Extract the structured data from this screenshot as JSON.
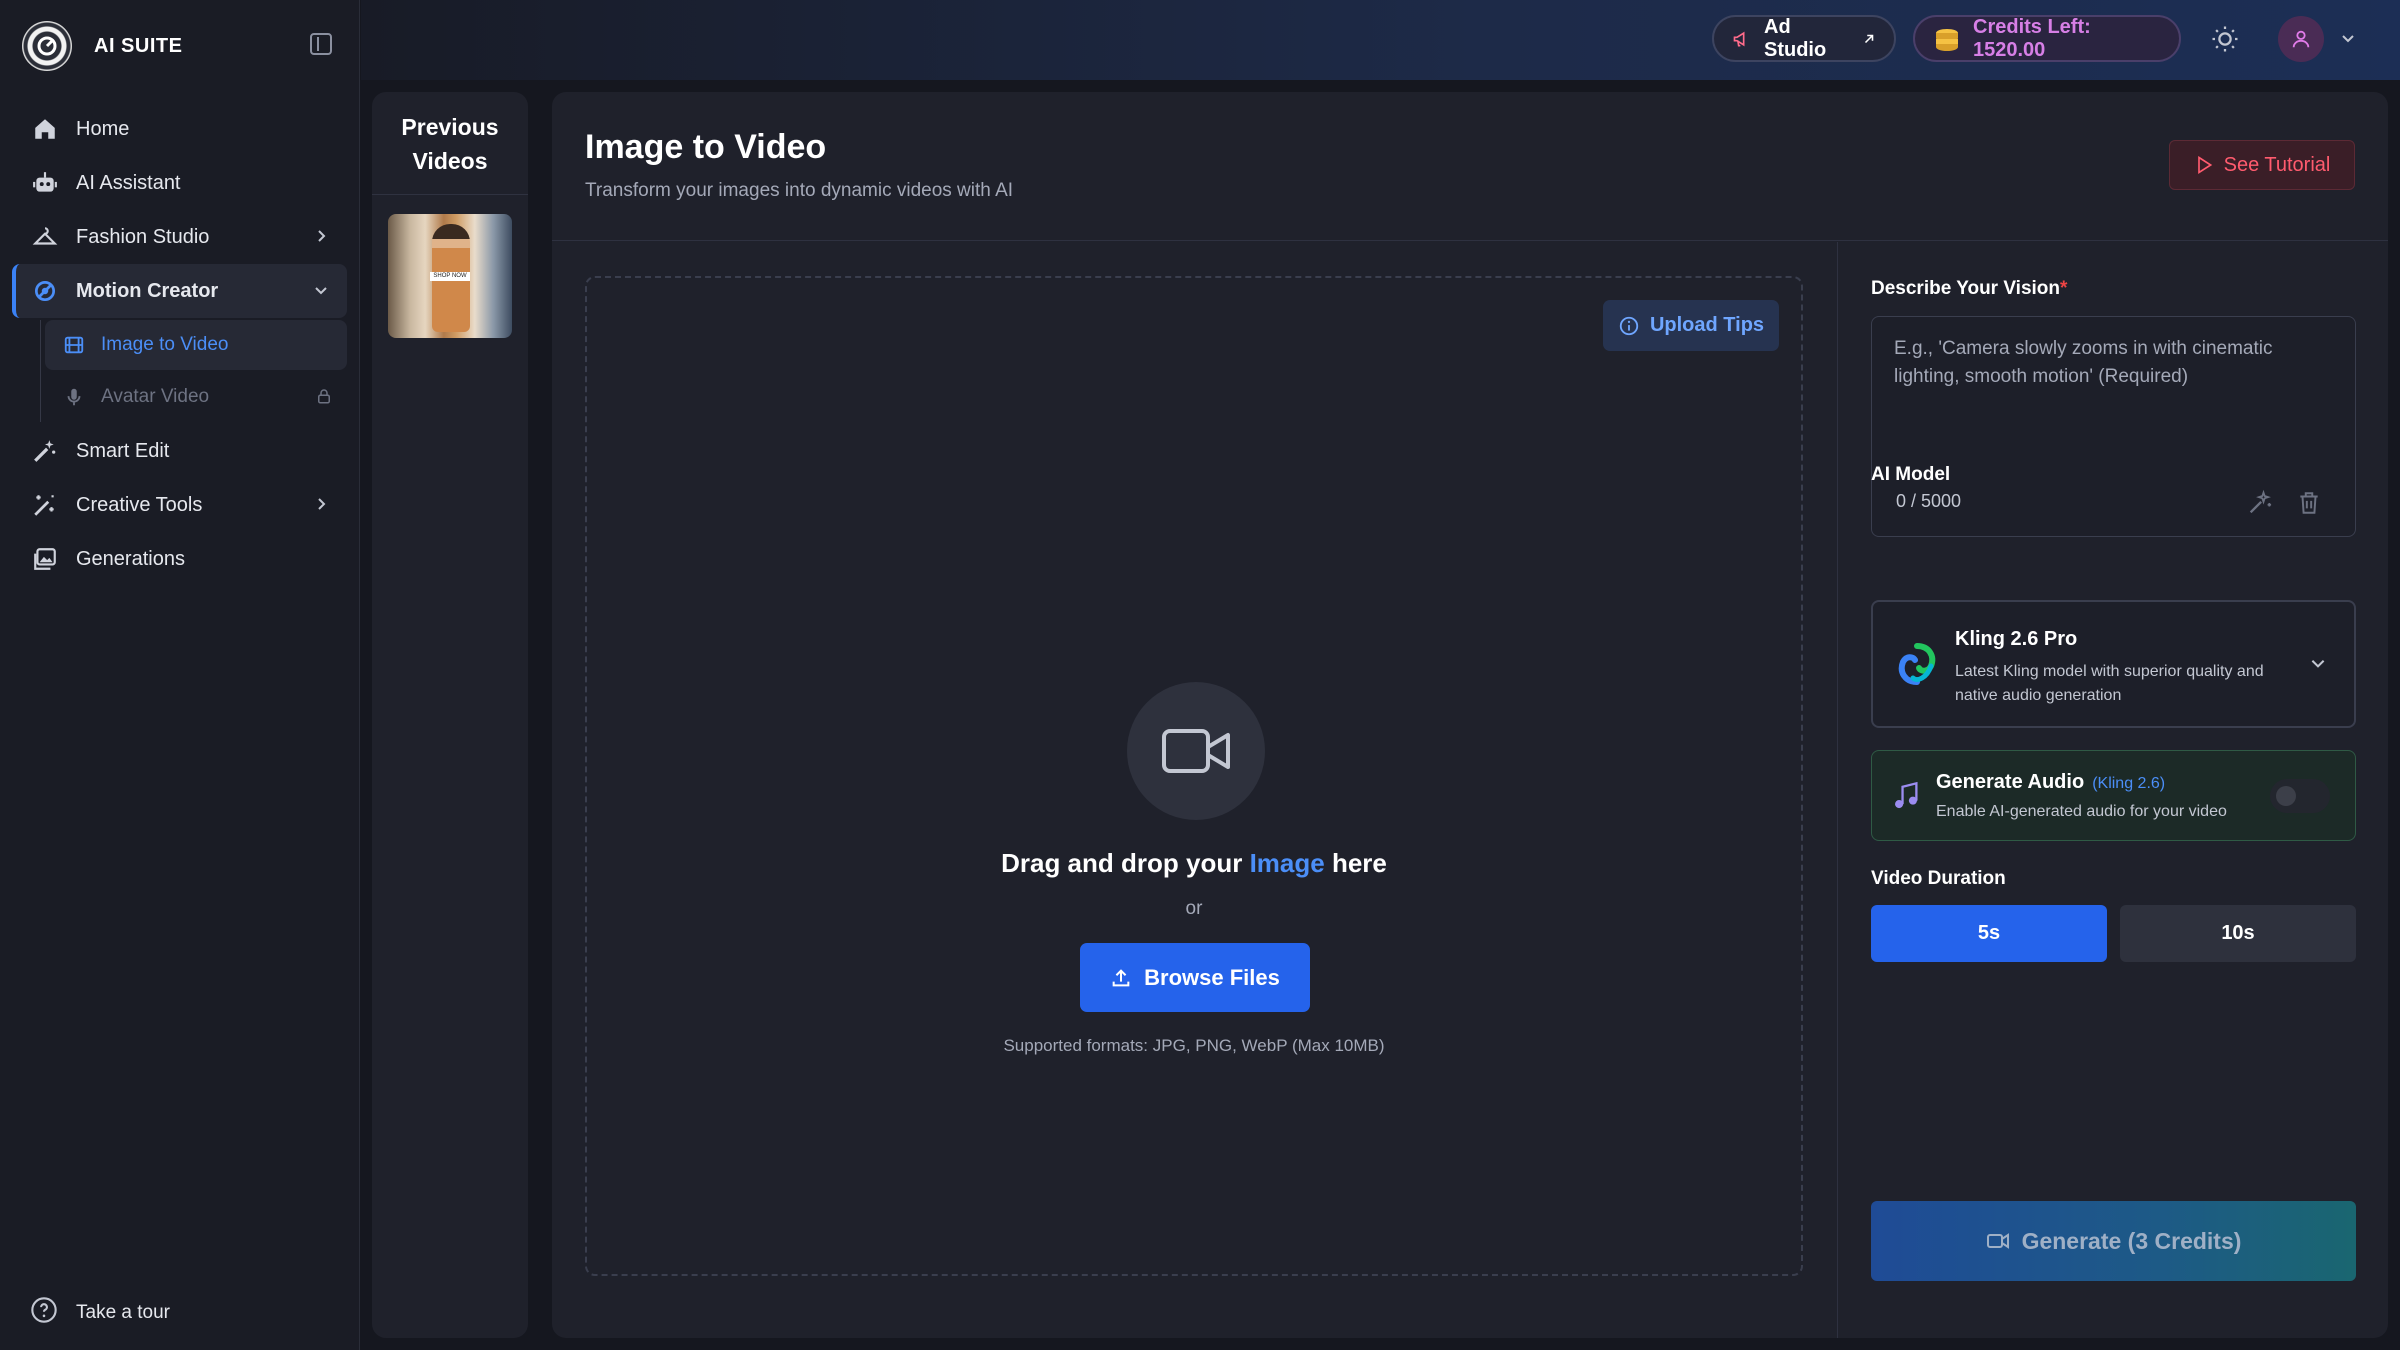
{
  "brand": {
    "name": "AI SUITE"
  },
  "sidebar": {
    "items": [
      {
        "label": "Home",
        "icon": "home-icon"
      },
      {
        "label": "AI Assistant",
        "icon": "robot-icon"
      },
      {
        "label": "Fashion Studio",
        "icon": "hanger-icon",
        "expandable": true
      },
      {
        "label": "Motion Creator",
        "icon": "motion-icon",
        "expandable": true,
        "expanded": true,
        "active": true
      },
      {
        "label": "Smart Edit",
        "icon": "magic-wand-icon"
      },
      {
        "label": "Creative Tools",
        "icon": "wand-sparkle-icon",
        "expandable": true
      },
      {
        "label": "Generations",
        "icon": "gallery-icon"
      }
    ],
    "sub_items": [
      {
        "label": "Image to Video",
        "icon": "film-icon",
        "active": true
      },
      {
        "label": "Avatar Video",
        "icon": "microphone-icon",
        "locked": true
      }
    ],
    "tour_label": "Take a tour"
  },
  "topbar": {
    "ad_studio_label": "Ad Studio",
    "credits_label": "Credits Left: 1520.00",
    "credits_color": "#d77fe6"
  },
  "previous": {
    "title_line1": "Previous",
    "title_line2": "Videos",
    "thumb_label": "SHOP NOW"
  },
  "main": {
    "title": "Image to Video",
    "subtitle": "Transform your images into dynamic videos with AI",
    "tutorial_label": "See Tutorial",
    "upload_tips_label": "Upload Tips",
    "drop_prefix": "Drag and drop your",
    "drop_highlight": "Image",
    "drop_suffix": "here",
    "or_label": "or",
    "browse_label": "Browse Files",
    "formats": "Supported formats: JPG, PNG, WebP (Max 10MB)"
  },
  "settings": {
    "vision_label": "Describe Your Vision",
    "vision_required_mark": "*",
    "vision_value": "",
    "vision_placeholder": "E.g., 'Camera slowly zooms in with cinematic lighting, smooth motion' (Required)",
    "char_count": "0 / 5000",
    "model_label": "AI Model",
    "model_name": "Kling 2.6 Pro",
    "model_desc": "Latest Kling model with superior quality and native audio generation",
    "audio_title": "Generate Audio",
    "audio_tag": "(Kling 2.6)",
    "audio_sub": "Enable AI-generated audio for your video",
    "audio_enabled": false,
    "duration_label": "Video Duration",
    "durations": [
      "5s",
      "10s"
    ],
    "duration_selected": "5s",
    "generate_label": "Generate (3 Credits)"
  },
  "colors": {
    "accent": "#2563eb",
    "link": "#4b8ef7",
    "danger": "#ff5b6e",
    "panel": "#1f212b"
  }
}
